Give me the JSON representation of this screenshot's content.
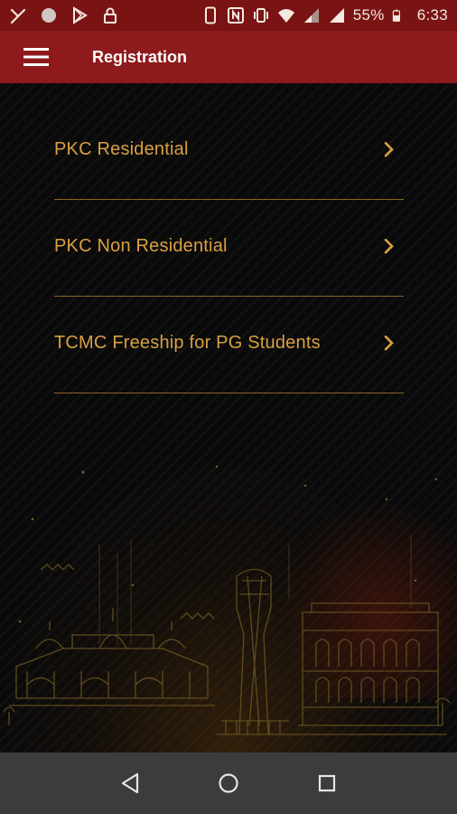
{
  "status_bar": {
    "icons": [
      "missed-call-icon",
      "circle-icon",
      "play-store-icon",
      "lock-icon",
      "phone-icon",
      "nfc-icon",
      "vibrate-icon",
      "wifi-icon",
      "signal-icon",
      "signal-icon-2",
      "battery-icon"
    ],
    "battery_percent": "55%",
    "time": "6:33"
  },
  "app_bar": {
    "title": "Registration",
    "background": "#8e1a1c"
  },
  "menu": {
    "accent_color": "#d9a040",
    "items": [
      {
        "label": "PKC Residential"
      },
      {
        "label": "PKC Non Residential"
      },
      {
        "label": "TCMC Freeship for PG Students"
      }
    ]
  },
  "nav_bar": {
    "buttons": [
      "back-icon",
      "home-icon",
      "recents-icon"
    ]
  }
}
